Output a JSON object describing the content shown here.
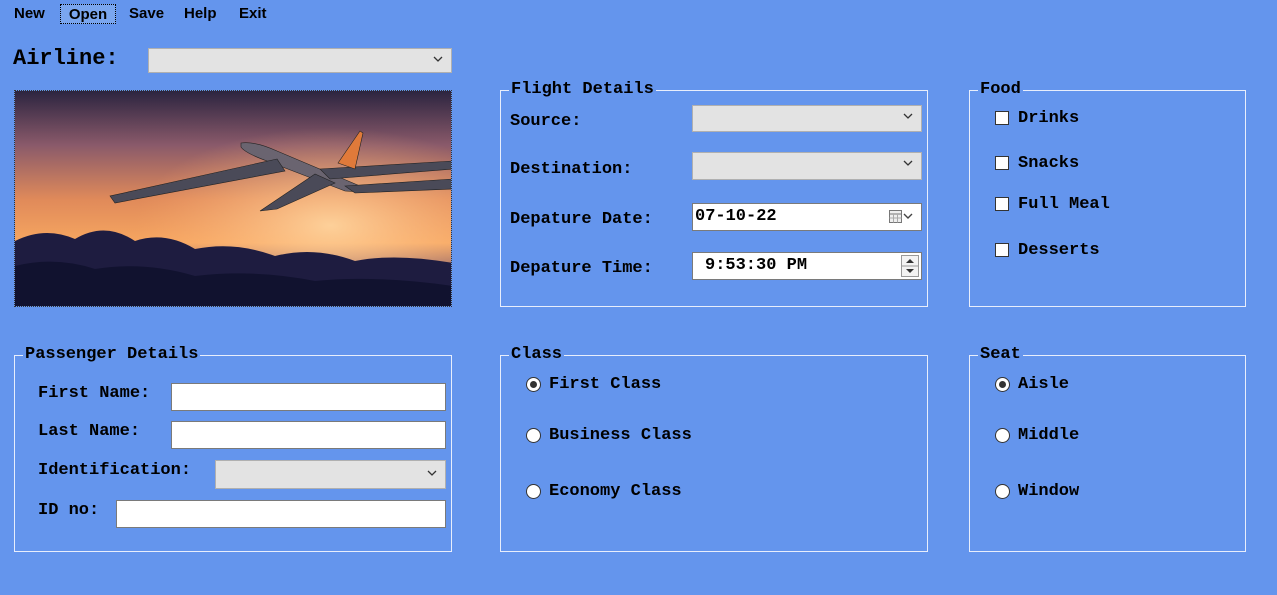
{
  "menu": {
    "new": "New",
    "open": "Open",
    "save": "Save",
    "help": "Help",
    "exit": "Exit"
  },
  "airline": {
    "label": "Airline:",
    "value": ""
  },
  "flight_details": {
    "title": "Flight Details",
    "source_label": "Source:",
    "source_value": "",
    "destination_label": "Destination:",
    "destination_value": "",
    "departure_date_label": "Depature Date:",
    "departure_date_value": "07-10-22",
    "departure_time_label": "Depature Time:",
    "departure_time_value": "9:53:30 PM"
  },
  "food": {
    "title": "Food",
    "items": [
      {
        "label": "Drinks",
        "checked": false
      },
      {
        "label": "Snacks",
        "checked": false
      },
      {
        "label": "Full Meal",
        "checked": false
      },
      {
        "label": "Desserts",
        "checked": false
      }
    ]
  },
  "passenger": {
    "title": "Passenger Details",
    "first_name_label": "First Name:",
    "first_name_value": "",
    "last_name_label": "Last Name:",
    "last_name_value": "",
    "identification_label": "Identification:",
    "identification_value": "",
    "id_no_label": "ID no:",
    "id_no_value": ""
  },
  "class": {
    "title": "Class",
    "options": [
      {
        "label": "First Class",
        "selected": true
      },
      {
        "label": "Business Class",
        "selected": false
      },
      {
        "label": "Economy Class",
        "selected": false
      }
    ]
  },
  "seat": {
    "title": "Seat",
    "options": [
      {
        "label": "Aisle",
        "selected": true
      },
      {
        "label": "Middle",
        "selected": false
      },
      {
        "label": "Window",
        "selected": false
      }
    ]
  },
  "colors": {
    "background": "#6495ED",
    "combo_bg": "#e3e3e3",
    "group_border": "#e8eefc"
  }
}
